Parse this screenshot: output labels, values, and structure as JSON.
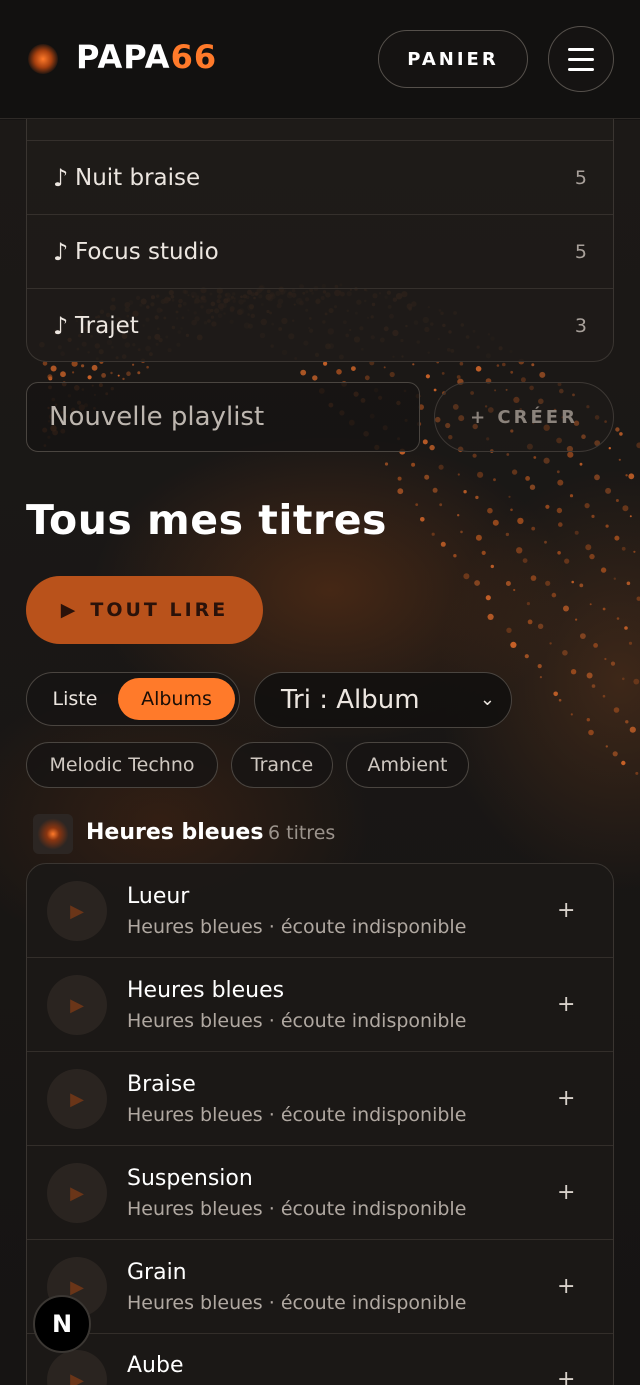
{
  "header": {
    "logo_main": "PAPA",
    "logo_accent": "66",
    "cart_label": "PANIER",
    "menu_icon": "hamburger-icon"
  },
  "playlists": [
    {
      "name": "Nuit braise",
      "count": "5"
    },
    {
      "name": "Focus studio",
      "count": "5"
    },
    {
      "name": "Trajet",
      "count": "3"
    }
  ],
  "new_playlist": {
    "placeholder": "Nouvelle playlist",
    "create_label": "+ CRÉER"
  },
  "library": {
    "title": "Tous mes titres",
    "play_all_label": "TOUT LIRE",
    "view": {
      "liste": "Liste",
      "albums": "Albums",
      "selected": "Albums"
    },
    "sort_value": "Tri : Album",
    "genres": [
      "Melodic Techno",
      "Trance",
      "Ambient"
    ]
  },
  "album": {
    "name": "Heures bleues",
    "count": "6 titres",
    "tracks": [
      {
        "title": "Lueur",
        "subtitle": "Heures bleues · écoute indisponible"
      },
      {
        "title": "Heures bleues",
        "subtitle": "Heures bleues · écoute indisponible"
      },
      {
        "title": "Braise",
        "subtitle": "Heures bleues · écoute indisponible"
      },
      {
        "title": "Suspension",
        "subtitle": "Heures bleues · écoute indisponible"
      },
      {
        "title": "Grain",
        "subtitle": "Heures bleues · écoute indisponible"
      },
      {
        "title": "Aube",
        "subtitle": ""
      }
    ]
  },
  "badge_letter": "N",
  "colors": {
    "accent": "#ff7a2a",
    "background": "#151312"
  }
}
